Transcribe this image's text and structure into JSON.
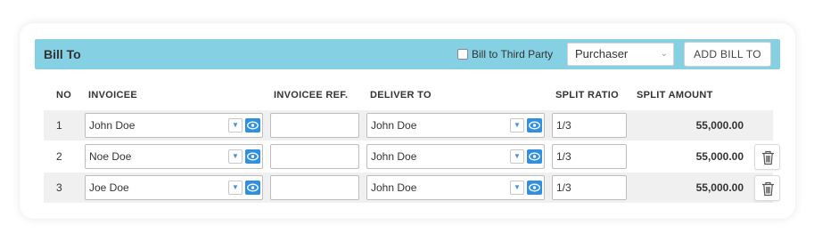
{
  "bill_to": {
    "title": "Bill To",
    "third_party_label": "Bill to Third Party",
    "bill_to_select_value": "Purchaser",
    "add_button_label": "ADD BILL TO"
  },
  "columns": {
    "no": "NO",
    "invoicee": "INVOICEE",
    "invoicee_ref": "INVOICEE REF.",
    "deliver_to": "DELIVER TO",
    "split_ratio": "SPLIT RATIO",
    "split_amount": "SPLIT AMOUNT"
  },
  "rows": [
    {
      "no": "1",
      "invoicee": "John Doe",
      "invoicee_ref": "",
      "deliver_to": "John Doe",
      "split_ratio": "1/3",
      "split_amount": "55,000.00",
      "deletable": false
    },
    {
      "no": "2",
      "invoicee": "Noe Doe",
      "invoicee_ref": "",
      "deliver_to": "John Doe",
      "split_ratio": "1/3",
      "split_amount": "55,000.00",
      "deletable": true
    },
    {
      "no": "3",
      "invoicee": "Joe Doe",
      "invoicee_ref": "",
      "deliver_to": "John Doe",
      "split_ratio": "1/3",
      "split_amount": "55,000.00",
      "deletable": true
    }
  ],
  "colors": {
    "header_bar": "#85d0e3",
    "eye_button": "#2f8fe0",
    "row_shade": "#f0f0f0"
  },
  "icons": {
    "dropdown": "chevron-down-icon",
    "view": "eye-icon",
    "delete": "trash-icon"
  }
}
